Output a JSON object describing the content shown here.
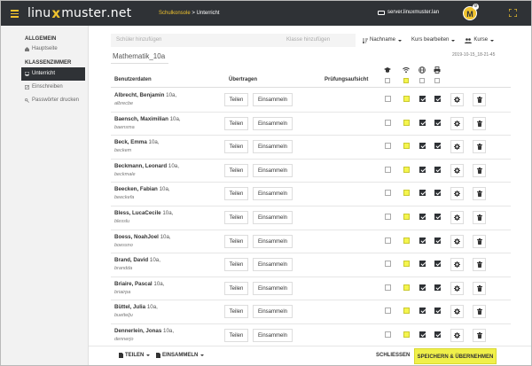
{
  "header": {
    "brand_prefix": "linu",
    "brand_x": "x",
    "brand_main": "muster",
    "brand_suffix": ".net",
    "crumb_link": "Schulkonsole",
    "crumb_sep": " > ",
    "crumb_current": "Unterricht",
    "server": "server.linuxmuster.lan",
    "avatar_letter": "M",
    "avatar_badge": "⚙"
  },
  "sidebar": {
    "section_general": "ALLGEMEIN",
    "item_home": "Hauptseite",
    "section_classroom": "KLASSENZIMMER",
    "item_lesson": "Unterricht",
    "item_enroll": "Einschreiben",
    "item_passwords": "Passwörter drucken"
  },
  "toolbar": {
    "student_placeholder": "Schüler hinzufügen",
    "class_placeholder": "Klasse hinzufügen",
    "sort_label": "Nachname",
    "edit_course": "Kurs bearbeiten",
    "courses": "Kurse"
  },
  "group": {
    "title": "Mathematik_10a",
    "timestamp": "2019-10-15_18-21-45"
  },
  "columns": {
    "user": "Benutzerdaten",
    "transfer": "Übertragen",
    "exam": "Prüfungsaufsicht"
  },
  "buttons": {
    "share": "Teilen",
    "collect": "Einsammeln"
  },
  "students": [
    {
      "name": "Albrecht, Benjamin",
      "class": "10a,",
      "login": "albrecbe"
    },
    {
      "name": "Baensch, Maximilian",
      "class": "10a,",
      "login": "baensma"
    },
    {
      "name": "Beck, Emma",
      "class": "10a,",
      "login": "beckem"
    },
    {
      "name": "Beckmann, Leonard",
      "class": "10a,",
      "login": "beckmale"
    },
    {
      "name": "Beecken, Fabian",
      "class": "10a,",
      "login": "beeckefa"
    },
    {
      "name": "Bless, LucaCecile",
      "class": "10a,",
      "login": "blesslu"
    },
    {
      "name": "Boess, NoahJoel",
      "class": "10a,",
      "login": "boessno"
    },
    {
      "name": "Brand, David",
      "class": "10a,",
      "login": "brandda"
    },
    {
      "name": "Briaire, Pascal",
      "class": "10a,",
      "login": "briairpa"
    },
    {
      "name": "Büttel, Julia",
      "class": "10a,",
      "login": "buettelju"
    },
    {
      "name": "Dennerlein, Jonas",
      "class": "10a,",
      "login": "dennerjo"
    }
  ],
  "footer": {
    "share": "TEILEN",
    "collect": "EINSAMMELN",
    "close": "SCHLIESSEN",
    "save": "SPEICHERN & ÜBERNEHMEN"
  },
  "colors": {
    "topbar": "#2f3236",
    "accent": "#f0c32e",
    "save": "#f0f04a"
  }
}
